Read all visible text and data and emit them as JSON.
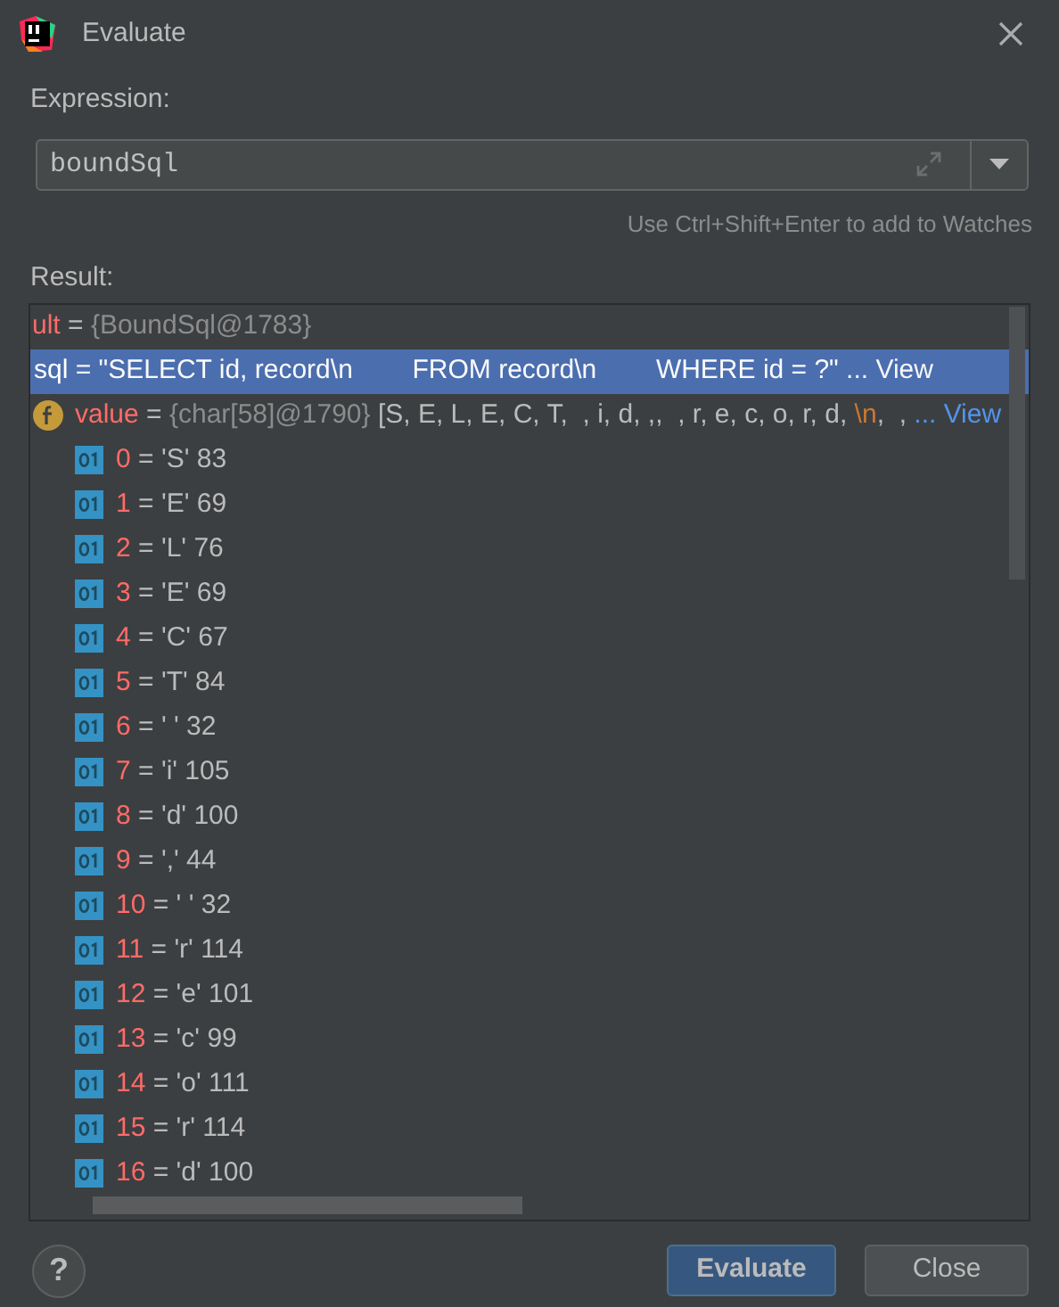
{
  "window": {
    "title": "Evaluate"
  },
  "expression": {
    "label": "Expression:",
    "value": "boundSql"
  },
  "hint": "Use Ctrl+Shift+Enter to add to Watches",
  "result_label": "Result:",
  "tree": [
    {
      "selected": false,
      "parts": [
        {
          "kind": "name",
          "text": "ult"
        },
        {
          "kind": "op",
          "text": " = "
        },
        {
          "kind": "type",
          "text": "{BoundSql@1783}"
        }
      ],
      "children": [
        {
          "selected": true,
          "parts": [
            {
              "kind": "name",
              "text": "sql"
            },
            {
              "kind": "op",
              "text": " = "
            },
            {
              "kind": "value",
              "text": "\"SELECT id, record\\n        FROM record\\n        WHERE id = ?\""
            },
            {
              "kind": "link",
              "text": " ... View"
            }
          ],
          "children": [
            {
              "kind": "field",
              "selected": false,
              "parts": [
                {
                  "kind": "name",
                  "text": "value"
                },
                {
                  "kind": "op",
                  "text": " = "
                },
                {
                  "kind": "type",
                  "text": "{char[58]@1790}"
                },
                {
                  "kind": "value",
                  "text": " [S, E, L, E, C, T,  , i, d, ,,  , r, e, c, o, r, d, "
                },
                {
                  "kind": "escape",
                  "text": "\\n"
                },
                {
                  "kind": "value",
                  "text": ",  ,"
                },
                {
                  "kind": "link",
                  "text": " ... View"
                }
              ],
              "children": [
                {
                  "kind": "primitive",
                  "selected": false,
                  "parts": [
                    {
                      "kind": "name",
                      "text": "0"
                    },
                    {
                      "kind": "op",
                      "text": " = "
                    },
                    {
                      "kind": "value",
                      "text": "'S' 83"
                    }
                  ]
                },
                {
                  "kind": "primitive",
                  "selected": false,
                  "parts": [
                    {
                      "kind": "name",
                      "text": "1"
                    },
                    {
                      "kind": "op",
                      "text": " = "
                    },
                    {
                      "kind": "value",
                      "text": "'E' 69"
                    }
                  ]
                },
                {
                  "kind": "primitive",
                  "selected": false,
                  "parts": [
                    {
                      "kind": "name",
                      "text": "2"
                    },
                    {
                      "kind": "op",
                      "text": " = "
                    },
                    {
                      "kind": "value",
                      "text": "'L' 76"
                    }
                  ]
                },
                {
                  "kind": "primitive",
                  "selected": false,
                  "parts": [
                    {
                      "kind": "name",
                      "text": "3"
                    },
                    {
                      "kind": "op",
                      "text": " = "
                    },
                    {
                      "kind": "value",
                      "text": "'E' 69"
                    }
                  ]
                },
                {
                  "kind": "primitive",
                  "selected": false,
                  "parts": [
                    {
                      "kind": "name",
                      "text": "4"
                    },
                    {
                      "kind": "op",
                      "text": " = "
                    },
                    {
                      "kind": "value",
                      "text": "'C' 67"
                    }
                  ]
                },
                {
                  "kind": "primitive",
                  "selected": false,
                  "parts": [
                    {
                      "kind": "name",
                      "text": "5"
                    },
                    {
                      "kind": "op",
                      "text": " = "
                    },
                    {
                      "kind": "value",
                      "text": "'T' 84"
                    }
                  ]
                },
                {
                  "kind": "primitive",
                  "selected": false,
                  "parts": [
                    {
                      "kind": "name",
                      "text": "6"
                    },
                    {
                      "kind": "op",
                      "text": " = "
                    },
                    {
                      "kind": "value",
                      "text": "' ' 32"
                    }
                  ]
                },
                {
                  "kind": "primitive",
                  "selected": false,
                  "parts": [
                    {
                      "kind": "name",
                      "text": "7"
                    },
                    {
                      "kind": "op",
                      "text": " = "
                    },
                    {
                      "kind": "value",
                      "text": "'i' 105"
                    }
                  ]
                },
                {
                  "kind": "primitive",
                  "selected": false,
                  "parts": [
                    {
                      "kind": "name",
                      "text": "8"
                    },
                    {
                      "kind": "op",
                      "text": " = "
                    },
                    {
                      "kind": "value",
                      "text": "'d' 100"
                    }
                  ]
                },
                {
                  "kind": "primitive",
                  "selected": false,
                  "parts": [
                    {
                      "kind": "name",
                      "text": "9"
                    },
                    {
                      "kind": "op",
                      "text": " = "
                    },
                    {
                      "kind": "value",
                      "text": "',' 44"
                    }
                  ]
                },
                {
                  "kind": "primitive",
                  "selected": false,
                  "parts": [
                    {
                      "kind": "name",
                      "text": "10"
                    },
                    {
                      "kind": "op",
                      "text": " = "
                    },
                    {
                      "kind": "value",
                      "text": "' ' 32"
                    }
                  ]
                },
                {
                  "kind": "primitive",
                  "selected": false,
                  "parts": [
                    {
                      "kind": "name",
                      "text": "11"
                    },
                    {
                      "kind": "op",
                      "text": " = "
                    },
                    {
                      "kind": "value",
                      "text": "'r' 114"
                    }
                  ]
                },
                {
                  "kind": "primitive",
                  "selected": false,
                  "parts": [
                    {
                      "kind": "name",
                      "text": "12"
                    },
                    {
                      "kind": "op",
                      "text": " = "
                    },
                    {
                      "kind": "value",
                      "text": "'e' 101"
                    }
                  ]
                },
                {
                  "kind": "primitive",
                  "selected": false,
                  "parts": [
                    {
                      "kind": "name",
                      "text": "13"
                    },
                    {
                      "kind": "op",
                      "text": " = "
                    },
                    {
                      "kind": "value",
                      "text": "'c' 99"
                    }
                  ]
                },
                {
                  "kind": "primitive",
                  "selected": false,
                  "parts": [
                    {
                      "kind": "name",
                      "text": "14"
                    },
                    {
                      "kind": "op",
                      "text": " = "
                    },
                    {
                      "kind": "value",
                      "text": "'o' 111"
                    }
                  ]
                },
                {
                  "kind": "primitive",
                  "selected": false,
                  "parts": [
                    {
                      "kind": "name",
                      "text": "15"
                    },
                    {
                      "kind": "op",
                      "text": " = "
                    },
                    {
                      "kind": "value",
                      "text": "'r' 114"
                    }
                  ]
                },
                {
                  "kind": "primitive",
                  "selected": false,
                  "parts": [
                    {
                      "kind": "name",
                      "text": "16"
                    },
                    {
                      "kind": "op",
                      "text": " = "
                    },
                    {
                      "kind": "value",
                      "text": "'d' 100"
                    }
                  ]
                }
              ]
            }
          ]
        }
      ]
    }
  ],
  "help": "?",
  "buttons": [
    {
      "label": "Evaluate",
      "kind": "default"
    },
    {
      "label": "Close",
      "kind": "normal"
    }
  ]
}
